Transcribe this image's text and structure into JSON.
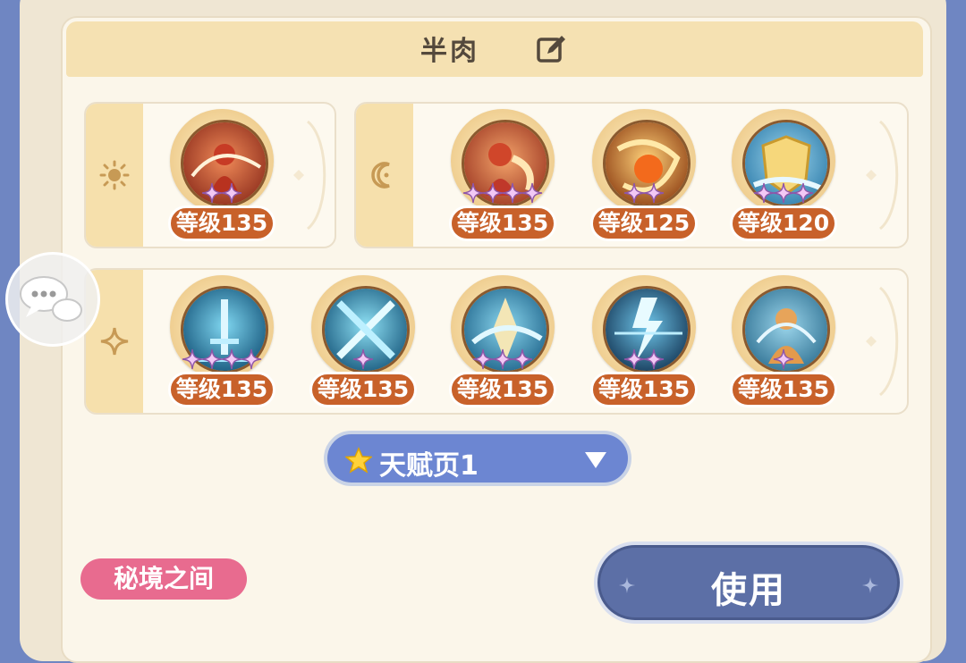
{
  "title": {
    "text": "半肉",
    "edit_icon": "edit-icon"
  },
  "row1_left": {
    "tab_icon": "sun-icon",
    "skills": [
      {
        "level": "等级135",
        "stars": 2,
        "art": "fire-hero"
      }
    ]
  },
  "row1_right": {
    "tab_icon": "moon-icon",
    "skills": [
      {
        "level": "等级135",
        "stars": 4,
        "art": "fire-hero-2"
      },
      {
        "level": "等级125",
        "stars": 2,
        "art": "fire-swirl"
      },
      {
        "level": "等级120",
        "stars": 3,
        "art": "shield"
      }
    ]
  },
  "row2": {
    "tab_icon": "sparkle-icon",
    "skills": [
      {
        "level": "等级135",
        "stars": 4,
        "art": "ice-sword"
      },
      {
        "level": "等级135",
        "stars": 1,
        "art": "ice-blades"
      },
      {
        "level": "等级135",
        "stars": 3,
        "art": "ice-crystal"
      },
      {
        "level": "等级135",
        "stars": 2,
        "art": "lightning"
      },
      {
        "level": "等级135",
        "stars": 1,
        "art": "aura-hero"
      }
    ]
  },
  "talent_page": {
    "label": "天赋页1",
    "icon": "star-icon",
    "dropdown_icon": "triangle-down-icon"
  },
  "mode_badge": {
    "label": "秘境之间"
  },
  "use_button": {
    "label": "使用"
  },
  "chat": {
    "icon": "chat-bubble-icon"
  },
  "colors": {
    "level_pill": "#c8612a",
    "title_bar": "#f5e1b2",
    "select": "#6c86d2",
    "use_button": "#5c6fa6",
    "mode_badge": "#e86b8f"
  }
}
